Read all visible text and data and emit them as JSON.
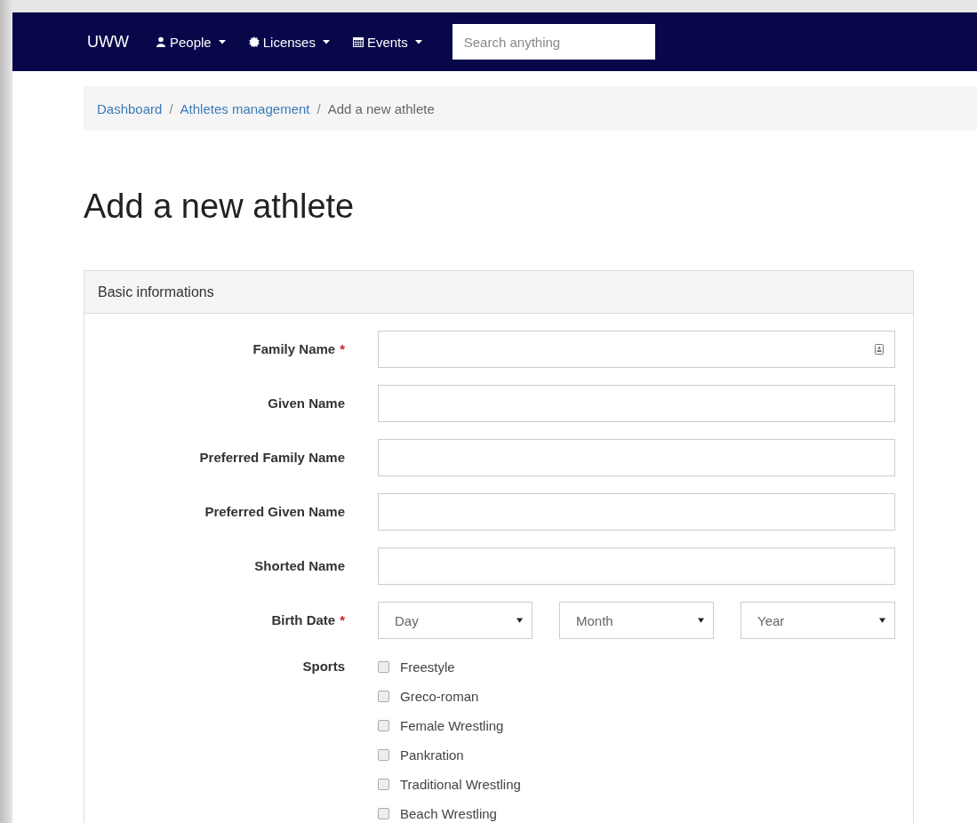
{
  "navbar": {
    "brand": "UWW",
    "menus": [
      {
        "label": "People",
        "kind": "user"
      },
      {
        "label": "Licenses",
        "kind": "badge"
      },
      {
        "label": "Events",
        "kind": "calendar"
      }
    ],
    "search": {
      "placeholder": "Search anything"
    }
  },
  "breadcrumb": [
    {
      "label": "Dashboard",
      "kind": "link",
      "separator": "/"
    },
    {
      "label": "Athletes management",
      "kind": "link",
      "separator": "/"
    },
    {
      "label": "Add a new athlete",
      "kind": "current"
    }
  ],
  "heading": "Add a new athlete",
  "panel": {
    "title": "Basic informations",
    "fields": [
      {
        "label": "Family Name",
        "required_mark": "*",
        "kind": "contact-text"
      },
      {
        "label": "Given Name",
        "kind": "text"
      },
      {
        "label": "Preferred Family Name",
        "kind": "text"
      },
      {
        "label": "Preferred Given Name",
        "kind": "text"
      },
      {
        "label": "Shorted Name",
        "kind": "text"
      },
      {
        "label": "Birth Date",
        "required_mark": "*",
        "kind": "date",
        "selects": [
          {
            "placeholder": "Day"
          },
          {
            "placeholder": "Month"
          },
          {
            "placeholder": "Year"
          }
        ]
      },
      {
        "label": "Sports",
        "kind": "checkboxes",
        "options": [
          {
            "label": "Freestyle",
            "checked": false
          },
          {
            "label": "Greco-roman",
            "checked": false
          },
          {
            "label": "Female Wrestling",
            "checked": false
          },
          {
            "label": "Pankration",
            "checked": false
          },
          {
            "label": "Traditional Wrestling",
            "checked": false
          },
          {
            "label": "Beach Wrestling",
            "checked": false
          }
        ]
      }
    ]
  }
}
